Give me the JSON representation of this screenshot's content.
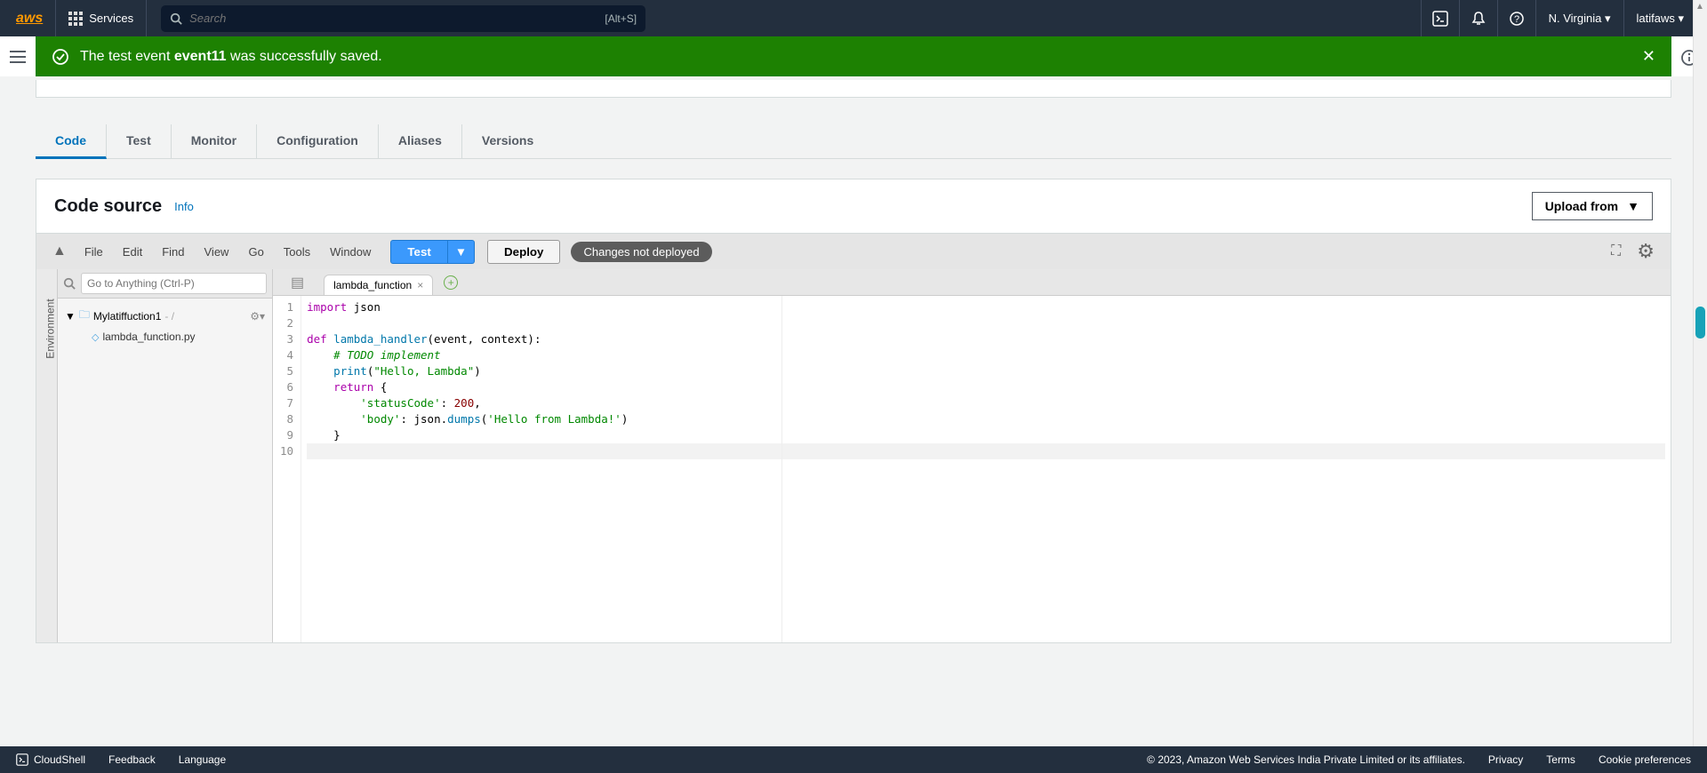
{
  "nav": {
    "logo": "aws",
    "services": "Services",
    "search_placeholder": "Search",
    "search_shortcut": "[Alt+S]",
    "region": "N. Virginia",
    "user": "latifaws"
  },
  "banner": {
    "prefix": "The test event ",
    "name": "event11",
    "suffix": " was successfully saved."
  },
  "tabs": [
    "Code",
    "Test",
    "Monitor",
    "Configuration",
    "Aliases",
    "Versions"
  ],
  "panel": {
    "title": "Code source",
    "info": "Info",
    "upload": "Upload from"
  },
  "ide": {
    "menus": [
      "File",
      "Edit",
      "Find",
      "View",
      "Go",
      "Tools",
      "Window"
    ],
    "test": "Test",
    "deploy": "Deploy",
    "status": "Changes not deployed",
    "search_placeholder": "Go to Anything (Ctrl-P)",
    "env_label": "Environment",
    "tree_root": "Mylatiffuction1",
    "tree_file": "lambda_function.py",
    "tab_name": "lambda_function"
  },
  "code": {
    "l1_kw": "import",
    "l1_mod": " json",
    "l3_kw1": "def ",
    "l3_fn": "lambda_handler",
    "l3_rest": "(event, context):",
    "l4": "    # TODO implement",
    "l5_a": "    ",
    "l5_fn": "print",
    "l5_b": "(",
    "l5_str": "\"Hello, Lambda\"",
    "l5_c": ")",
    "l6_a": "    ",
    "l6_kw": "return",
    "l6_b": " {",
    "l7_a": "        ",
    "l7_k": "'statusCode'",
    "l7_b": ": ",
    "l7_v": "200",
    "l7_c": ",",
    "l8_a": "        ",
    "l8_k": "'body'",
    "l8_b": ": json.",
    "l8_fn": "dumps",
    "l8_c": "(",
    "l8_v": "'Hello from Lambda!'",
    "l8_d": ")",
    "l9": "    }"
  },
  "line_numbers": [
    "1",
    "2",
    "3",
    "4",
    "5",
    "6",
    "7",
    "8",
    "9",
    "10"
  ],
  "footer": {
    "cloudshell": "CloudShell",
    "feedback": "Feedback",
    "language": "Language",
    "copyright": "© 2023, Amazon Web Services India Private Limited or its affiliates.",
    "privacy": "Privacy",
    "terms": "Terms",
    "cookie": "Cookie preferences"
  }
}
